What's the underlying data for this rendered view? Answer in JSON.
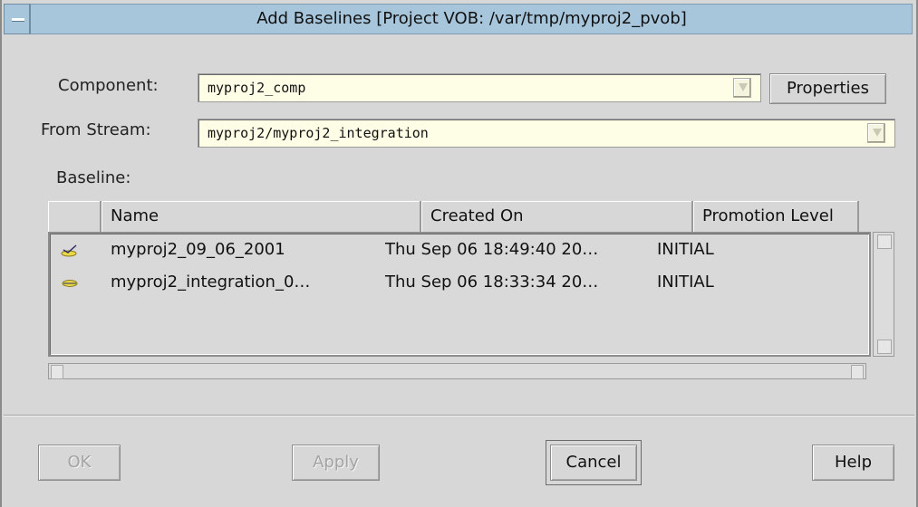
{
  "window": {
    "title": "Add Baselines  [Project VOB: /var/tmp/myproj2_pvob]"
  },
  "form": {
    "component_label": "Component:",
    "component_value": "myproj2_comp",
    "properties_button": "Properties",
    "stream_label": "From Stream:",
    "stream_value": "myproj2/myproj2_integration",
    "baseline_label": "Baseline:"
  },
  "table": {
    "columns": [
      "Name",
      "Created On",
      "Promotion Level"
    ],
    "rows": [
      {
        "icon": "baseline-checked-icon",
        "name": "myproj2_09_06_2001",
        "created": "Thu Sep 06 18:49:40 20…",
        "level": "INITIAL"
      },
      {
        "icon": "baseline-icon",
        "name": "myproj2_integration_0…",
        "created": "Thu Sep 06 18:33:34 20…",
        "level": "INITIAL"
      }
    ]
  },
  "buttons": {
    "ok": "OK",
    "apply": "Apply",
    "cancel": "Cancel",
    "help": "Help"
  },
  "colors": {
    "titlebar": "#a7c6dc",
    "field_bg": "#fefee6",
    "window_bg": "#d7d7d7",
    "baseline_icon": "#e8d84a"
  }
}
